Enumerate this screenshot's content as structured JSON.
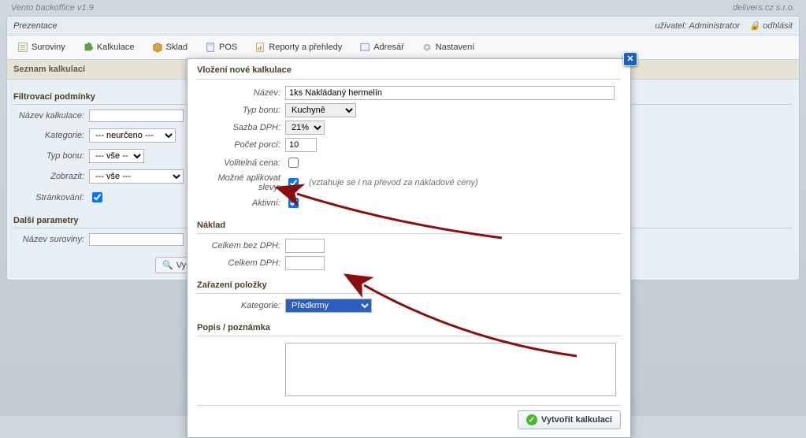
{
  "app": {
    "title": "Vento backoffice v1.9",
    "company": "delivers.cz s.r.o."
  },
  "header": {
    "breadcrumb": "Prezentace",
    "user_label": "uživatel: Administrator",
    "logout": "odhlásit"
  },
  "nav": {
    "suroviny": "Suroviny",
    "kalkulace": "Kalkulace",
    "sklad": "Sklad",
    "pos": "POS",
    "reporty": "Reporty a přehledy",
    "adresar": "Adresář",
    "nastaveni": "Nastavení"
  },
  "subheader": "Seznam kalkulací",
  "filter": {
    "title": "Filtrovací podmínky",
    "nazev_kalkulace_label": "Název kalkulace:",
    "nazev_kalkulace_value": "",
    "kategorie_label": "Kategorie:",
    "kategorie_value": "--- neurčeno ---",
    "typ_bonu_label": "Typ bonu:",
    "typ_bonu_value": "--- vše ---",
    "zobrazit_label": "Zobrazit:",
    "zobrazit_value": "--- vše ---",
    "strankovani_label": "Stránkování:"
  },
  "params": {
    "title": "Další parametry",
    "nazev_suroviny_label": "Název suroviny:",
    "nazev_suroviny_value": ""
  },
  "search_btn": "Vyhle",
  "modal": {
    "title": "Vložení nové kalkulace",
    "nazev_label": "Název:",
    "nazev_value": "1ks Nakládaný hermelín",
    "typ_bonu_label": "Typ bonu:",
    "typ_bonu_value": "Kuchyně",
    "sazba_dph_label": "Sazba DPH:",
    "sazba_dph_value": "21%",
    "pocet_porci_label": "Počet porcí:",
    "pocet_porci_value": "10",
    "volitelna_cena_label": "Volitelná cena:",
    "mozne_slevy_label": "Možné aplikovat slevy:",
    "mozne_slevy_hint": "(vztahuje se i na převod za nákladové ceny)",
    "aktivni_label": "Aktivní:",
    "naklad_title": "Náklad",
    "celkem_bez_dph_label": "Celkem bez DPH:",
    "celkem_bez_dph_value": "",
    "celkem_dph_label": "Celkem DPH:",
    "celkem_dph_value": "",
    "zarazeni_title": "Zařazení položky",
    "kategorie_label": "Kategorie:",
    "kategorie_value": "Předkrmy",
    "popis_title": "Popis / poznámka",
    "popis_value": "",
    "submit": "Vytvořit kalkulaci"
  }
}
